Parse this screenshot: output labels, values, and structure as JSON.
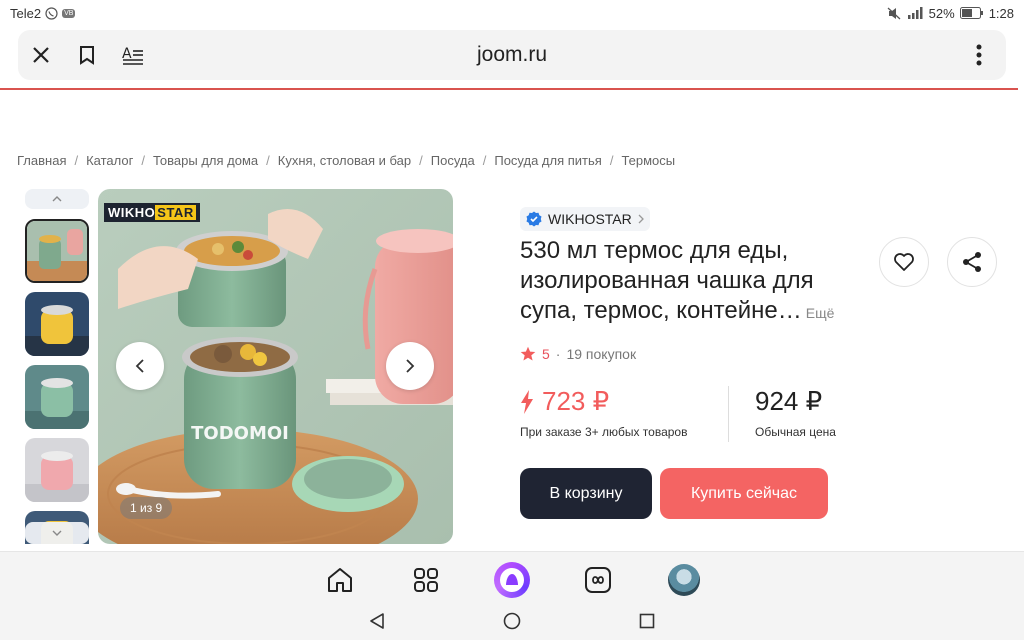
{
  "status_bar": {
    "carrier": "Tele2",
    "battery": "52%",
    "time": "1:28"
  },
  "browser": {
    "url": "joom.ru"
  },
  "breadcrumbs": [
    "Главная",
    "Каталог",
    "Товары для дома",
    "Кухня, столовая и бар",
    "Посуда",
    "Посуда для питья",
    "Термосы"
  ],
  "gallery": {
    "brand_tag_left": "WIKHO",
    "brand_tag_right": "STAR",
    "counter": "1 из 9",
    "product_print": "TODOMOI"
  },
  "product": {
    "seller": "WIKHOSTAR",
    "title": "530 мл термос для еды, изолированная чашка для супа, термос, контейне…",
    "more": "Ещё",
    "rating": "5",
    "dot": "·",
    "purchases": "19 покупок",
    "promo_price": "723 ₽",
    "promo_note": "При заказе 3+ любых товаров",
    "regular_price": "924 ₽",
    "regular_note": "Обычная цена",
    "cart_button": "В корзину",
    "buy_button": "Купить сейчас"
  },
  "colors": {
    "accent_red": "#f46463",
    "dark_button": "#1f2433",
    "verified_blue": "#2a7be4"
  }
}
